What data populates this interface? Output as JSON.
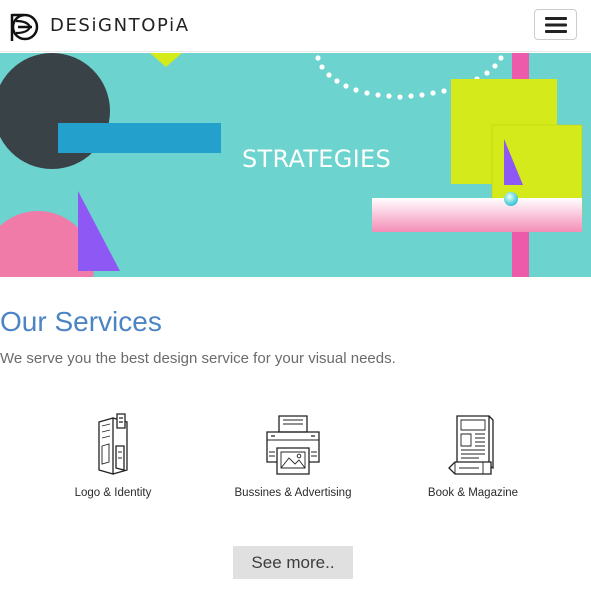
{
  "brand": {
    "name": "DESiGNTOPiA",
    "logo_icon": "design-logo-icon"
  },
  "nav": {
    "menu_icon": "hamburger-menu-icon"
  },
  "hero": {
    "title": "STRATEGIES",
    "colors": {
      "background": "#6dd3ce",
      "dark_circle": "#394246",
      "blue_bar": "#23a1cc",
      "lime": "#d5ea1a",
      "pink": "#f07aa8",
      "purple": "#8e58f4",
      "magenta": "#ec5aa9"
    }
  },
  "services": {
    "title": "Our Services",
    "subtitle": "We serve you the best design service for your visual needs.",
    "items": [
      {
        "label": "Logo & Identity",
        "icon": "folder-document-icon"
      },
      {
        "label": "Bussines & Advertising",
        "icon": "printer-icon"
      },
      {
        "label": "Book & Magazine",
        "icon": "magazine-pencil-icon"
      }
    ],
    "see_more_label": "See more.."
  },
  "colors": {
    "accent": "#4c84c4",
    "button_bg": "#e0e0e0"
  }
}
